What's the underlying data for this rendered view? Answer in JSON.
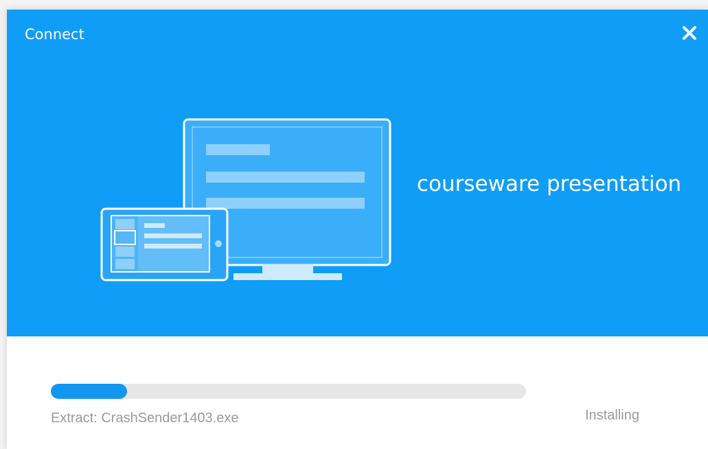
{
  "window": {
    "title": "Connect",
    "close_icon": "close-icon"
  },
  "hero": {
    "headline": "courseware presentation",
    "illustration": "monitor-and-tablet-illustration",
    "background_color": "#0f9df7"
  },
  "install": {
    "progress_fraction": 0.16,
    "progress_color": "#1296f0",
    "status_text": "Extract: CrashSender1403.exe",
    "state_label": "Installing"
  }
}
